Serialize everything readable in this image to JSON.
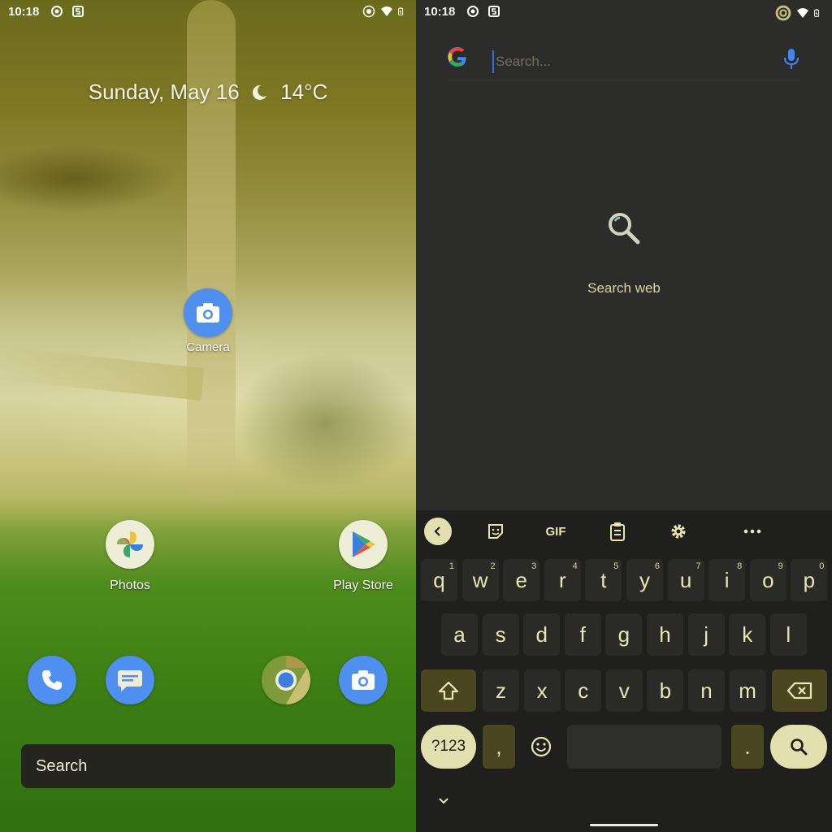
{
  "colors": {
    "kb_text": "#e9e6b6",
    "kb_accent": "#e3e0b0",
    "kb_fn": "#4a4720",
    "icon_blue": "#4f8ff0",
    "g_blue": "#4285f4"
  },
  "left": {
    "status": {
      "time": "10:18"
    },
    "at_a_glance": {
      "date": "Sunday, May 16",
      "weather_icon": "moon-icon",
      "temp": "14°C"
    },
    "apps": [
      {
        "name": "camera",
        "label": "Camera",
        "icon": "camera-icon"
      },
      {
        "name": "photos",
        "label": "Photos",
        "icon": "pinwheel-icon"
      },
      {
        "name": "play-store",
        "label": "Play Store",
        "icon": "play-triangle-icon"
      }
    ],
    "dock": [
      {
        "name": "phone",
        "icon": "phone-icon"
      },
      {
        "name": "messages",
        "icon": "message-icon"
      },
      {
        "name": "chrome",
        "icon": "chrome-icon"
      },
      {
        "name": "camera",
        "icon": "camera-icon"
      }
    ],
    "search_bar": {
      "label": "Search"
    }
  },
  "right": {
    "status": {
      "time": "10:18"
    },
    "search": {
      "placeholder": "Search...",
      "value": ""
    },
    "empty_state": {
      "label": "Search web"
    },
    "keyboard": {
      "toolbar": {
        "gif": "GIF"
      },
      "row1": [
        {
          "k": "q",
          "h": "1"
        },
        {
          "k": "w",
          "h": "2"
        },
        {
          "k": "e",
          "h": "3"
        },
        {
          "k": "r",
          "h": "4"
        },
        {
          "k": "t",
          "h": "5"
        },
        {
          "k": "y",
          "h": "6"
        },
        {
          "k": "u",
          "h": "7"
        },
        {
          "k": "i",
          "h": "8"
        },
        {
          "k": "o",
          "h": "9"
        },
        {
          "k": "p",
          "h": "0"
        }
      ],
      "row2": [
        "a",
        "s",
        "d",
        "f",
        "g",
        "h",
        "j",
        "k",
        "l"
      ],
      "row3": [
        "z",
        "x",
        "c",
        "v",
        "b",
        "n",
        "m"
      ],
      "symbols": "?123",
      "comma": ",",
      "period": "."
    }
  }
}
